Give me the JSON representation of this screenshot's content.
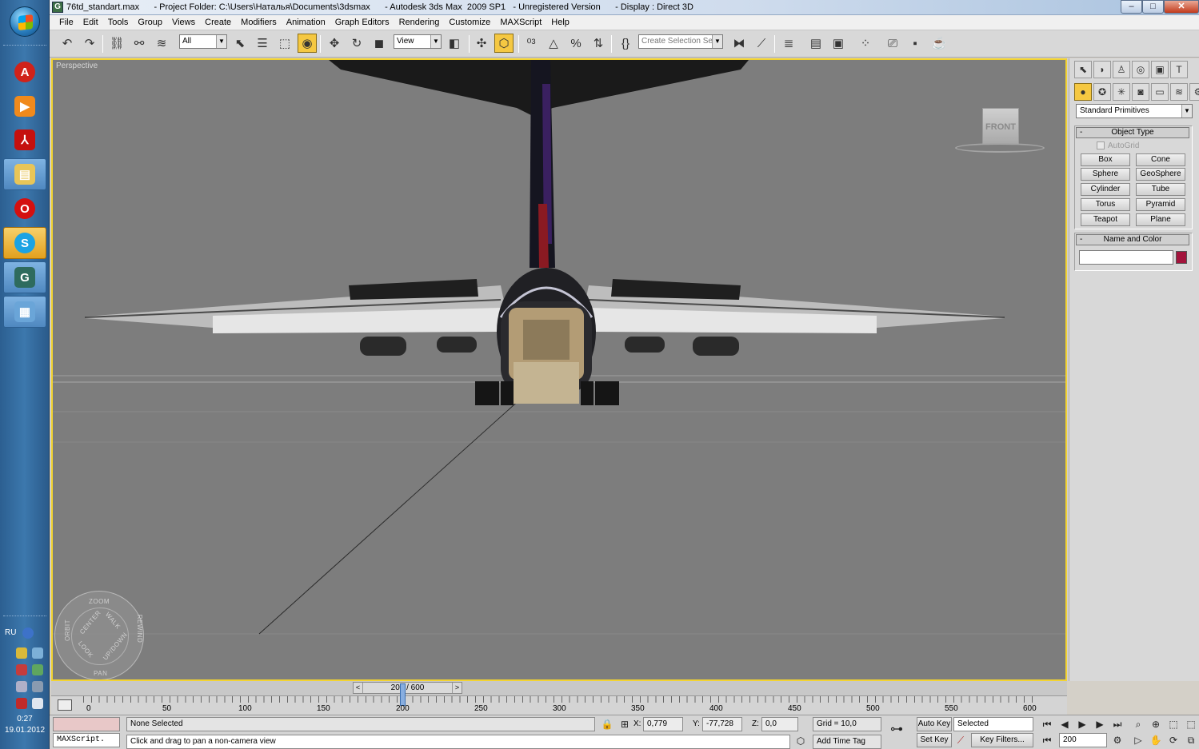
{
  "window": {
    "title": "76td_standart.max      - Project Folder: C:\\Users\\Наталья\\Documents\\3dsmax      - Autodesk 3ds Max  2009 SP1   - Unregistered Version      - Display : Direct 3D",
    "minimize": "‒",
    "maximize": "□",
    "close": "✕"
  },
  "menu": [
    "File",
    "Edit",
    "Tools",
    "Group",
    "Views",
    "Create",
    "Modifiers",
    "Animation",
    "Graph Editors",
    "Rendering",
    "Customize",
    "MAXScript",
    "Help"
  ],
  "toolbar": {
    "selection_filter": "All",
    "reference_coord": "View",
    "named_selection": "Create Selection Set"
  },
  "viewport": {
    "label": "Perspective",
    "viewcube_face": "FRONT",
    "wheel": {
      "zoom": "ZOOM",
      "orbit": "ORBIT",
      "pan": "PAN",
      "rewind": "REWIND",
      "center": "CENTER",
      "walk": "WALK",
      "look": "LOOK",
      "updown": "UP/DOWN"
    }
  },
  "command_panel": {
    "category": "Standard Primitives",
    "object_type_title": "Object Type",
    "autogrid": "AutoGrid",
    "primitives": [
      "Box",
      "Cone",
      "Sphere",
      "GeoSphere",
      "Cylinder",
      "Tube",
      "Torus",
      "Pyramid",
      "Teapot",
      "Plane"
    ],
    "name_color_title": "Name and Color",
    "object_color": "#a3143c"
  },
  "timeline": {
    "slider": "200 / 600",
    "prev": "<",
    "next": ">",
    "ticks": [
      "0",
      "50",
      "100",
      "150",
      "200",
      "250",
      "300",
      "350",
      "400",
      "450",
      "500",
      "550",
      "600"
    ],
    "current_frame_fraction": 0.333
  },
  "status": {
    "maxscript": "MAXScript.",
    "selection": "None Selected",
    "prompt": "Click and drag to pan a non-camera view",
    "x_label": "X:",
    "x": "0,779",
    "y_label": "Y:",
    "y": "-77,728",
    "z_label": "Z:",
    "z": "0,0",
    "grid": "Grid = 10,0",
    "add_time_tag": "Add Time Tag",
    "auto_key": "Auto Key",
    "set_key": "Set Key",
    "key_mode": "Selected",
    "key_filters": "Key Filters...",
    "frame": "200"
  },
  "taskbar": {
    "language": "RU",
    "time": "0:27",
    "date": "19.01.2012"
  }
}
